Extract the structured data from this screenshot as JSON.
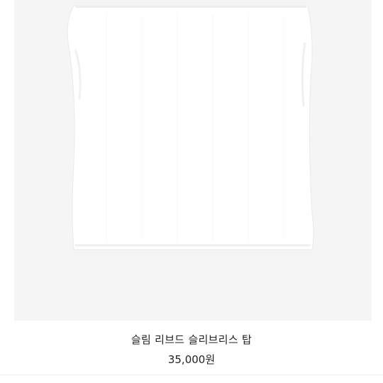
{
  "product": {
    "name": "슬림 리브드 슬리브리스 탑",
    "price": "35,000원",
    "image_icon": "sleeveless-top-photo"
  },
  "colors": {
    "image_background": "#f5f5f5",
    "garment": "#ffffff",
    "text": "#222222"
  }
}
